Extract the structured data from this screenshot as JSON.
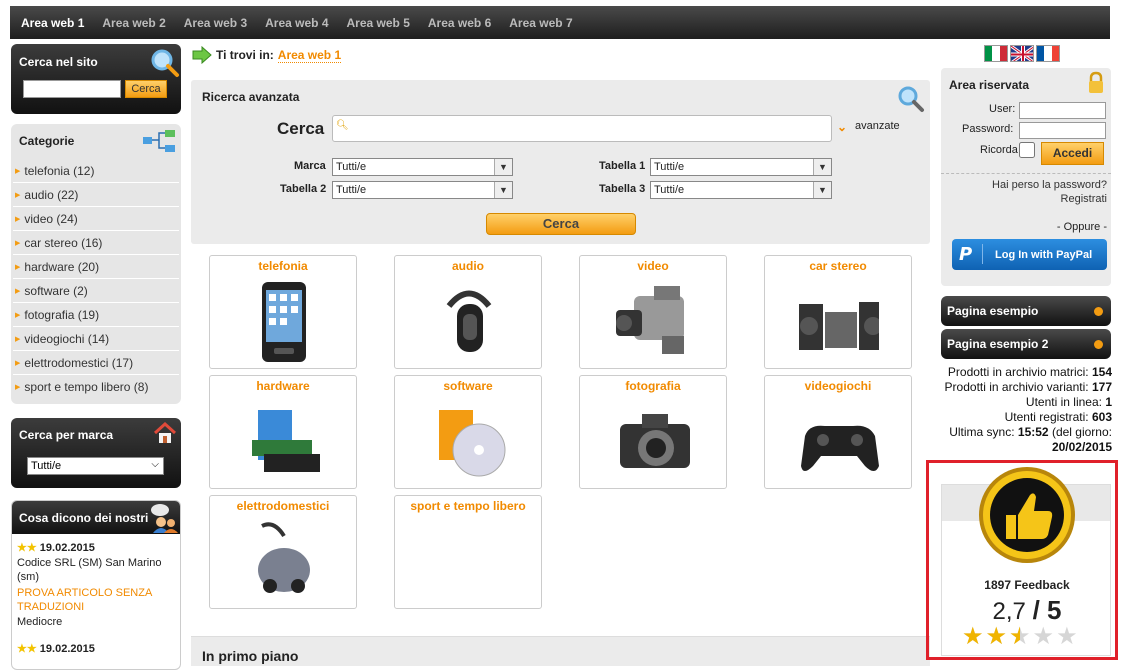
{
  "topnav": {
    "items": [
      "Area web 1",
      "Area web 2",
      "Area web 3",
      "Area web 4",
      "Area web 5",
      "Area web 6",
      "Area web 7"
    ]
  },
  "search_site": {
    "title": "Cerca nel sito",
    "button": "Cerca"
  },
  "categories": {
    "title": "Categorie",
    "items": [
      "telefonia (12)",
      "audio (22)",
      "video (24)",
      "car stereo (16)",
      "hardware (20)",
      "software (2)",
      "fotografia (19)",
      "videogiochi (14)",
      "elettrodomestici (17)",
      "sport e tempo libero (8)"
    ]
  },
  "brand": {
    "title": "Cerca per marca",
    "selected": "Tutti/e"
  },
  "reviews": {
    "title": "Cosa dicono dei nostri",
    "items": [
      {
        "date": "19.02.2015",
        "author": "Codice SRL (SM) San Marino (sm)",
        "product": "PROVA ARTICOLO SENZA TRADUZIONI",
        "rating": "Mediocre"
      },
      {
        "date": "19.02.2015"
      }
    ]
  },
  "breadcrumb": {
    "prefix": "Ti trovi in:",
    "link": "Area web 1"
  },
  "advanced": {
    "title": "Ricerca avanzata",
    "cerca_label": "Cerca",
    "avanzate": "avanzate",
    "marca_label": "Marca",
    "marca_value": "Tutti/e",
    "tab1_label": "Tabella 1",
    "tab1_value": "Tutti/e",
    "tab2_label": "Tabella 2",
    "tab2_value": "Tutti/e",
    "tab3_label": "Tabella 3",
    "tab3_value": "Tutti/e",
    "button": "Cerca"
  },
  "products": [
    "telefonia",
    "audio",
    "video",
    "car stereo",
    "hardware",
    "software",
    "fotografia",
    "videogiochi",
    "elettrodomestici",
    "sport e tempo libero"
  ],
  "in_primo_piano": "In primo piano",
  "reserved": {
    "title": "Area riservata",
    "user_label": "User:",
    "password_label": "Password:",
    "remember_label": "Ricorda",
    "login_button": "Accedi",
    "forgot": "Hai perso la password?",
    "register": "Registrati",
    "or": "- Oppure -",
    "paypal": "Log In with PayPal"
  },
  "pages": [
    "Pagina esempio",
    "Pagina esempio 2"
  ],
  "stats": {
    "matrici_label": "Prodotti in archivio matrici:",
    "matrici": "154",
    "varianti_label": "Prodotti in archivio varianti:",
    "varianti": "177",
    "online_label": "Utenti in linea:",
    "online": "1",
    "registered_label": "Utenti registrati:",
    "registered": "603",
    "sync_label": "Ultima sync:",
    "sync_time": "15:52",
    "sync_mid": "(del giorno:",
    "sync_date": "20/02/2015"
  },
  "feedback": {
    "count": "1897 Feedback",
    "score": "2,7",
    "max": "5",
    "rating": 2.5
  },
  "colors": {
    "accent": "#f18a00",
    "highlight": "#e0202a",
    "dark": "#1e1e1e"
  }
}
